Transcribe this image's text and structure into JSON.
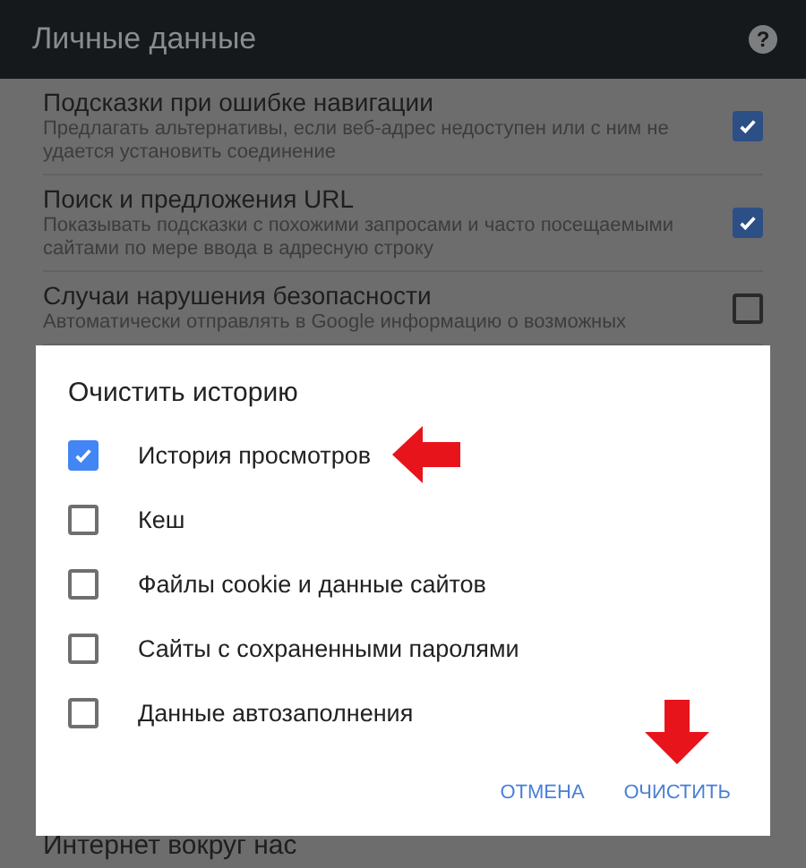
{
  "header": {
    "title": "Личные данные",
    "help_icon": "?"
  },
  "settings": [
    {
      "title": "Подсказки при ошибке навигации",
      "description": "Предлагать альтернативы, если веб-адрес недоступен или с ним не удается установить соединение",
      "checked": true
    },
    {
      "title": "Поиск и предложения URL",
      "description": "Показывать подсказки с похожими запросами и часто посещаемыми сайтами по мере ввода в адресную строку",
      "checked": true
    },
    {
      "title": "Случаи нарушения безопасности",
      "description": "Автоматически отправлять в Google информацию о возможных",
      "checked": false
    }
  ],
  "bottom_item": "Интернет вокруг нас",
  "dialog": {
    "title": "Очистить историю",
    "options": [
      {
        "label": "История просмотров",
        "checked": true,
        "arrow": true
      },
      {
        "label": "Кеш",
        "checked": false,
        "arrow": false
      },
      {
        "label": "Файлы cookie и данные сайтов",
        "checked": false,
        "arrow": false
      },
      {
        "label": "Сайты с сохраненными паролями",
        "checked": false,
        "arrow": false
      },
      {
        "label": "Данные автозаполнения",
        "checked": false,
        "arrow": false
      }
    ],
    "buttons": [
      {
        "label": "ОТМЕНА",
        "arrow": false
      },
      {
        "label": "ОЧИСТИТЬ",
        "arrow": true
      }
    ]
  }
}
